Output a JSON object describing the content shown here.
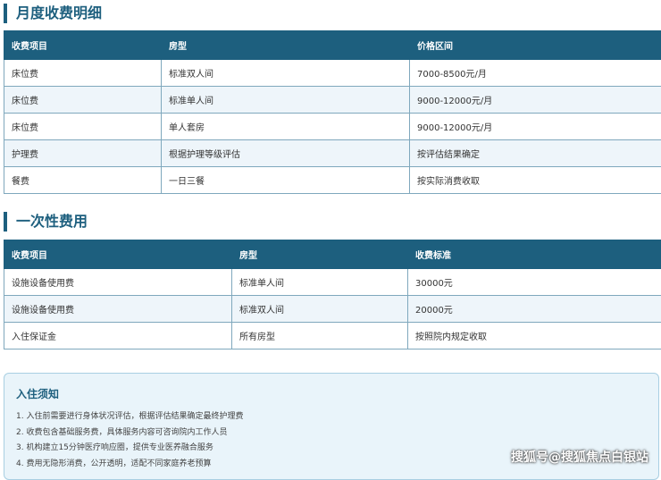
{
  "monthly": {
    "title": "月度收费明细",
    "headers": [
      "收费项目",
      "房型",
      "价格区间"
    ],
    "rows": [
      [
        "床位费",
        "标准双人间",
        "7000-8500元/月"
      ],
      [
        "床位费",
        "标准单人间",
        "9000-12000元/月"
      ],
      [
        "床位费",
        "单人套房",
        "9000-12000元/月"
      ],
      [
        "护理费",
        "根据护理等级评估",
        "按评估结果确定"
      ],
      [
        "餐费",
        "一日三餐",
        "按实际消费收取"
      ]
    ]
  },
  "onetime": {
    "title": "一次性费用",
    "headers": [
      "收费项目",
      "房型",
      "收费标准"
    ],
    "rows": [
      [
        "设施设备使用费",
        "标准单人间",
        "30000元"
      ],
      [
        "设施设备使用费",
        "标准双人间",
        "20000元"
      ],
      [
        "入住保证金",
        "所有房型",
        "按照院内规定收取"
      ]
    ]
  },
  "notice": {
    "title": "入住须知",
    "items": [
      "1. 入住前需要进行身体状况评估，根据评估结果确定最终护理费",
      "2. 收费包含基础服务费，具体服务内容可咨询院内工作人员",
      "3. 机构建立15分钟医疗响应圈，提供专业医养融合服务",
      "4. 费用无隐形消费，公开透明，适配不同家庭养老预算"
    ]
  },
  "watermark": "搜狐号@搜狐焦点白银站"
}
